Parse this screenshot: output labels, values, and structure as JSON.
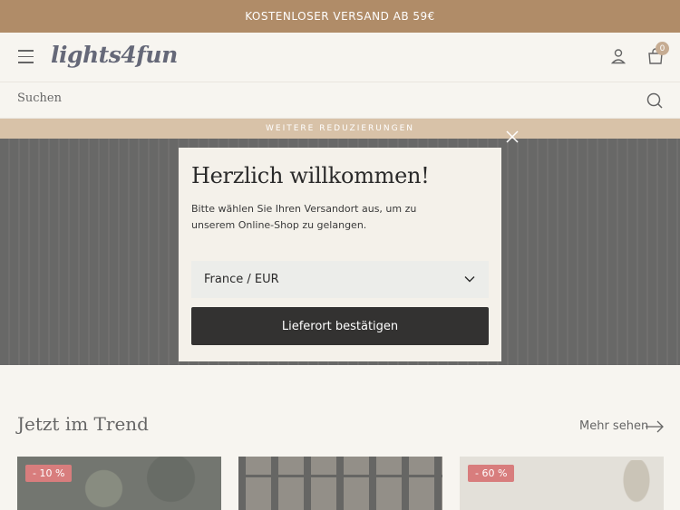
{
  "promo_bar": {
    "text": "KOSTENLOSER VERSAND AB 59€"
  },
  "header": {
    "logo": "lights4fun",
    "cart_count": "0",
    "menu_icon": "hamburger-menu-icon",
    "account_icon": "user-icon",
    "cart_icon": "shopping-bag-icon"
  },
  "search": {
    "label": "Suchen",
    "icon": "search-icon"
  },
  "sub_promo": {
    "text": "WEITERE REDUZIERUNGEN"
  },
  "trend": {
    "title": "Jetzt im Trend",
    "more_label": "Mehr sehen",
    "products": [
      {
        "badge": "- 10 %"
      },
      {
        "badge": ""
      },
      {
        "badge": "- 60 %"
      }
    ]
  },
  "modal": {
    "title": "Herzlich willkommen!",
    "description": "Bitte wählen Sie Ihren Versandort aus, um zu unserem Online-Shop zu gelangen.",
    "selected_country": "France / EUR",
    "confirm_label": "Lieferort bestätigen"
  },
  "colors": {
    "promo_bg": "#b08c68",
    "sub_promo_bg": "#c9ab87",
    "page_bg": "#f4f1ea",
    "button_bg": "#333231",
    "badge_bg": "#c94c4c"
  }
}
